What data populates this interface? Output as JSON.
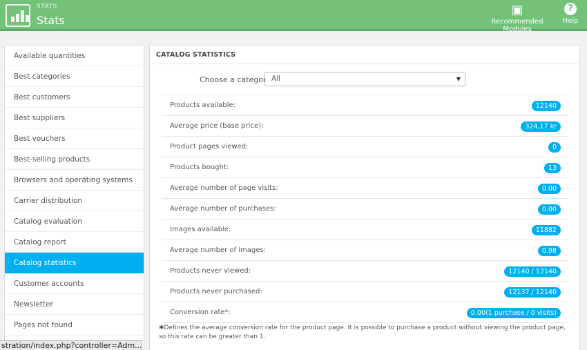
{
  "header": {
    "subtitle": "STATS",
    "title": "Stats",
    "recommended_label": "Recommended Modules",
    "help_label": "Help"
  },
  "sidebar": {
    "items": [
      {
        "label": "Available quantities"
      },
      {
        "label": "Best categories"
      },
      {
        "label": "Best customers"
      },
      {
        "label": "Best suppliers"
      },
      {
        "label": "Best vouchers"
      },
      {
        "label": "Best-selling products"
      },
      {
        "label": "Browsers and operating systems"
      },
      {
        "label": "Carrier distribution"
      },
      {
        "label": "Catalog evaluation"
      },
      {
        "label": "Catalog report"
      },
      {
        "label": "Catalog statistics",
        "active": true
      },
      {
        "label": "Customer accounts"
      },
      {
        "label": "Newsletter"
      },
      {
        "label": "Pages not found"
      }
    ]
  },
  "statusbar": {
    "text": "stration/index.php?controller=Adm..."
  },
  "panel": {
    "heading": "CATALOG STATISTICS",
    "choose_label": "Choose a category",
    "category_selected": "All",
    "stats": [
      {
        "label": "Products available:",
        "value": "12140"
      },
      {
        "label": "Average price (base price):",
        "value": "324,17 kr"
      },
      {
        "label": "Product pages viewed:",
        "value": "0"
      },
      {
        "label": "Products bought:",
        "value": "13"
      },
      {
        "label": "Average number of page visits:",
        "value": "0.00"
      },
      {
        "label": "Average number of purchases:",
        "value": "0.00"
      },
      {
        "label": "Images available:",
        "value": "11882"
      },
      {
        "label": "Average number of images:",
        "value": "0.98"
      },
      {
        "label": "Products never viewed:",
        "value": "12140 / 12140"
      },
      {
        "label": "Products never purchased:",
        "value": "12137 / 12140"
      },
      {
        "label": "Conversion rate*:",
        "value": "0.00(1 purchase / 0 visits)"
      }
    ],
    "footnote": "Defines the average conversion rate for the product page. It is possible to purchase a product without viewing the product page, so this rate can be greater than 1."
  },
  "colors": {
    "header": "#72c279",
    "accent": "#00aff0"
  }
}
